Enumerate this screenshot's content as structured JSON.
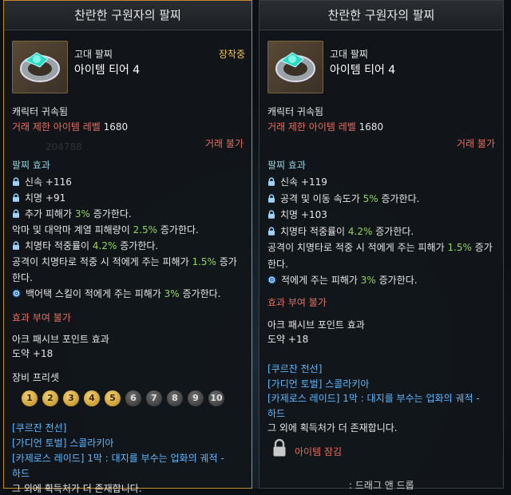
{
  "left": {
    "title": "찬란한 구원자의 팔찌",
    "grade": "고대 팔찌",
    "tier": "아이템 티어 4",
    "equipped": "장착중",
    "bound": "캐릭터 귀속됨",
    "trade_label": "거래 제한 아이템 레벨",
    "trade_level": "1680",
    "trade_status": "거래 불가",
    "effects_heading": "팔찌 효과",
    "effects": [
      {
        "icon": "lock-icon",
        "text": "신속 +116"
      },
      {
        "icon": "lock-icon",
        "text": "치명 +91"
      },
      {
        "icon": "lock-icon",
        "pre": "추가 피해가 ",
        "hl": "3%",
        "post": " 증가한다."
      },
      {
        "icon": "",
        "pre": "악마 및 대악마 계열 피해량이 ",
        "hl": "2.5%",
        "post": " 증가한다."
      },
      {
        "icon": "lock-icon",
        "pre": "치명타 적중률이 ",
        "hl": "4.2%",
        "post": " 증가한다."
      },
      {
        "icon": "",
        "pre": "공격이 치명타로 적중 시 적에게 주는 피해가 ",
        "hl": "1.5%",
        "post": " 증가"
      },
      {
        "icon": "",
        "text": "한다."
      },
      {
        "icon": "swirl-icon",
        "pre": "백어택 스킬이 적에게 주는 피해가 ",
        "hl": "3%",
        "post": " 증가한다."
      }
    ],
    "no_grant": "효과 부여 불가",
    "ark_heading": "아크 패시브 포인트 효과",
    "ark_value": "도약 +18",
    "preset_heading": "장비 프리셋",
    "presets": [
      "1",
      "2",
      "3",
      "4",
      "5",
      "6",
      "7",
      "8",
      "9",
      "10"
    ],
    "sources": [
      "[쿠르잔 전선]",
      "[가디언 토벌] 스콜라키아",
      "[카제로스 레이드] 1막 : 대지를 부수는 업화의 궤적 -",
      "하드",
      "그 외에 획득처가 더 존재합니다."
    ],
    "bg_number": "204788"
  },
  "right": {
    "title": "찬란한 구원자의 팔찌",
    "grade": "고대 팔찌",
    "tier": "아이템 티어 4",
    "bound": "캐릭터 귀속됨",
    "trade_label": "거래 제한 아이템 레벨",
    "trade_level": "1680",
    "trade_status": "거래 불가",
    "effects_heading": "팔찌 효과",
    "effects": [
      {
        "icon": "lock-icon",
        "text": "신속 +119"
      },
      {
        "icon": "lock-icon",
        "pre": "공격 및 이동 속도가 ",
        "hl": "5%",
        "post": " 증가한다."
      },
      {
        "icon": "lock-icon",
        "text": "치명 +103"
      },
      {
        "icon": "lock-icon",
        "pre": "치명타 적중률이 ",
        "hl": "4.2%",
        "post": " 증가한다."
      },
      {
        "icon": "",
        "pre": "공격이 치명타로 적중 시 적에게 주는 피해가 ",
        "hl": "1.5%",
        "post": " 증가"
      },
      {
        "icon": "",
        "text": "한다."
      },
      {
        "icon": "swirl-icon",
        "pre": "적에게 주는 피해가 ",
        "hl": "3%",
        "post": " 증가한다."
      }
    ],
    "no_grant": "효과 부여 불가",
    "ark_heading": "아크 패시브 포인트 효과",
    "ark_value": "도약 +18",
    "sources": [
      "[쿠르잔 전선]",
      "[가디언 토벌] 스콜라키아",
      "[카제로스 레이드] 1막 : 대지를 부수는 업화의 궤적 -",
      "하드",
      "그 외에 획득처가 더 존재합니다."
    ],
    "locked": "아이템 잠김",
    "footer": ": 드래그 앤 드롭"
  }
}
